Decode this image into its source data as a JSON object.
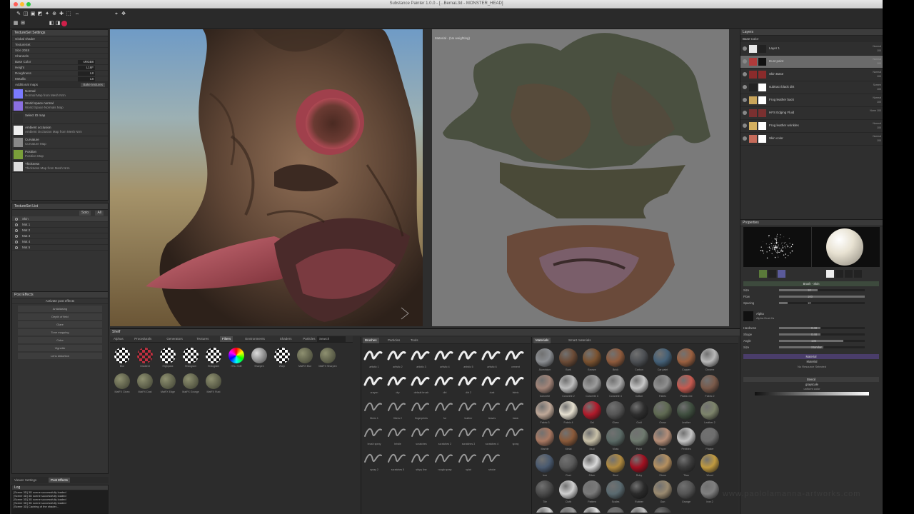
{
  "window": {
    "title": "Substance Painter 1.0.0 - [...BernaL3d - MONSTER_HEAD]"
  },
  "left": {
    "texset_settings": {
      "header": "TextureSet Settings",
      "rows": [
        {
          "label": "Global shader",
          "value": ""
        },
        {
          "label": "TextureSet",
          "value": ""
        },
        {
          "label": "Size  2048",
          "value": ""
        },
        {
          "label": "Channels",
          "value": ""
        },
        {
          "label": "Base Color",
          "value": "sRGB8"
        },
        {
          "label": "Height",
          "value": "L16F"
        },
        {
          "label": "Roughness",
          "value": "L8"
        },
        {
          "label": "Metallic",
          "value": "L8"
        }
      ],
      "maps_label": "Additional maps",
      "maps_button": "Bake textures",
      "maps": [
        {
          "name": "Normal",
          "sub": "Normal Map from Mesh Nrm",
          "color": "#7a7aff"
        },
        {
          "name": "World space normal",
          "sub": "World Space Normals Map",
          "color": "#8a6fe0"
        },
        {
          "name": "Select ID map",
          "sub": "",
          "color": "#2f2f2f"
        },
        {
          "name": "Ambient occlusion",
          "sub": "Ambient Occlusion Map from Mesh Nrm",
          "color": "#eeeeee"
        },
        {
          "name": "Curvature",
          "sub": "Curvature Map",
          "color": "#888888"
        },
        {
          "name": "Position",
          "sub": "Position Map",
          "color": "#7a9f3a"
        },
        {
          "name": "Thickness",
          "sub": "Thickness Map from Mesh Nrm",
          "color": "#dddddd"
        }
      ]
    },
    "texset_list": {
      "header": "TextureSet List",
      "solo_label": "Solo",
      "all_label": "All",
      "items": [
        "Skin",
        "Mat 1",
        "Mat 2",
        "Mat 3",
        "Mat 4",
        "Mat 5"
      ]
    },
    "post_effects": {
      "header": "Post Effects",
      "activate": "Activate post effects",
      "items": [
        "Antialiasing",
        "Depth of field",
        "Glare",
        "Tone mapping",
        "Color",
        "Vignette",
        "Lens distortion"
      ]
    },
    "bottom_tabs": [
      "Viewer Settings",
      "Post Effects"
    ],
    "log": {
      "header": "Log",
      "lines": [
        "[Scene 3D] 3D scene successfully loaded",
        "[Scene 3D] 3D scene successfully loaded",
        "[Scene 3D] 3D scene successfully loaded",
        "[Scene 3D] 3D scene successfully loaded",
        "[Scene 3D] Caching of the shader..."
      ]
    }
  },
  "viewport2d": {
    "label": "Material - (No weighting)"
  },
  "shelf": {
    "header": "Shelf",
    "tabs": [
      "Alphas",
      "Procedurals",
      "Generators",
      "Textures",
      "Filters",
      "Environments",
      "Shaders",
      "Particles",
      "All"
    ],
    "active_tab": "Filters",
    "search": "Search",
    "filters": [
      {
        "label": "Blur",
        "kind": "check"
      },
      {
        "label": "Gradient",
        "kind": "red"
      },
      {
        "label": "Highpass",
        "kind": "check"
      },
      {
        "label": "Histogram",
        "kind": "check"
      },
      {
        "label": "Histogram",
        "kind": "check"
      },
      {
        "label": "HSL Shift",
        "kind": "rainbow"
      },
      {
        "label": "Sharpen",
        "kind": "grey"
      },
      {
        "label": "Warp",
        "kind": "check"
      },
      {
        "label": "MatFX Blur",
        "kind": "olive"
      },
      {
        "label": "MatFX Sharpen",
        "kind": "olive"
      },
      {
        "label": "MatFX Clean",
        "kind": "olive"
      },
      {
        "label": "MatFX Dust",
        "kind": "olive"
      },
      {
        "label": "MatFX Edge",
        "kind": "olive"
      },
      {
        "label": "MatFX Grunge",
        "kind": "olive"
      },
      {
        "label": "MatFX Rust",
        "kind": "olive"
      }
    ],
    "brush_tabs": [
      "Brushes",
      "Particles",
      "Tools"
    ],
    "brush_labels": [
      "artistic 1",
      "artistic 2",
      "artistic 3",
      "artistic 4",
      "artistic 5",
      "artistic 6",
      "cement",
      "crayon",
      "dry",
      "default brush",
      "dirt",
      "dirt 2",
      "dust",
      "fabric",
      "fibers 1",
      "fibers 2",
      "fingerprints",
      "fur",
      "leather",
      "leaves",
      "basic",
      "brush spray",
      "bristle",
      "scratches",
      "scratches 2",
      "scratches 3",
      "scratches 4",
      "spray",
      "spray 2",
      "scratches 5",
      "stripy line",
      "rough spray",
      "splat",
      "stroke"
    ],
    "mat_tabs": [
      "Materials",
      "Smart materials"
    ],
    "materials": [
      {
        "label": "Aluminium",
        "c": "#8a8d91"
      },
      {
        "label": "Bark",
        "c": "#6b4b36"
      },
      {
        "label": "Bronze",
        "c": "#7a5230"
      },
      {
        "label": "Brick",
        "c": "#8e5a3c"
      },
      {
        "label": "Carbon",
        "c": "#4d5054"
      },
      {
        "label": "Car paint",
        "c": "#446077"
      },
      {
        "label": "Copper",
        "c": "#9a6040"
      },
      {
        "label": "Chrome",
        "c": "#b8b8b8"
      },
      {
        "label": "Concrete",
        "c": "#a28478"
      },
      {
        "label": "Concrete 2",
        "c": "#bdbdbd"
      },
      {
        "label": "Concrete 3",
        "c": "#9c9c9c"
      },
      {
        "label": "Concrete 4",
        "c": "#ababab"
      },
      {
        "label": "Cotton",
        "c": "#c7c7c7"
      },
      {
        "label": "Fabric",
        "c": "#8f8f8f"
      },
      {
        "label": "Plastic red",
        "c": "#c55a50"
      },
      {
        "label": "Fabric 2",
        "c": "#7a5a4a"
      },
      {
        "label": "Fabric 3",
        "c": "#bfa898"
      },
      {
        "label": "Fabric 4",
        "c": "#e6e0d0"
      },
      {
        "label": "Gel",
        "c": "#b01a2a"
      },
      {
        "label": "Glass",
        "c": "#555"
      },
      {
        "label": "Gold",
        "c": "#2d2d2d"
      },
      {
        "label": "Grass",
        "c": "#5f6a52"
      },
      {
        "label": "Leather",
        "c": "#3f4e3f"
      },
      {
        "label": "Leather 2",
        "c": "#7d846b"
      },
      {
        "label": "Marble",
        "c": "#a87862"
      },
      {
        "label": "Metal",
        "c": "#8a5a3a"
      },
      {
        "label": "Mud",
        "c": "#c8c0a8"
      },
      {
        "label": "Moss",
        "c": "#5b6a66"
      },
      {
        "label": "Paint",
        "c": "#6f7a6f"
      },
      {
        "label": "Paper",
        "c": "#b58e78"
      },
      {
        "label": "Pebbles",
        "c": "#c4c4c4"
      },
      {
        "label": "Plaster",
        "c": "#6d6d6d"
      },
      {
        "label": "Iron",
        "c": "#4a5a70"
      },
      {
        "label": "Rust",
        "c": "#5a5a5a"
      },
      {
        "label": "Silver",
        "c": "#d8d8d8"
      },
      {
        "label": "Steel",
        "c": "#b08a40"
      },
      {
        "label": "Ruby",
        "c": "#a01020"
      },
      {
        "label": "Stone",
        "c": "#b59060"
      },
      {
        "label": "Titan",
        "c": "#3a3a3a"
      },
      {
        "label": "Wood",
        "c": "#c09a40"
      },
      {
        "label": "Tile",
        "c": "#4a4a4a"
      },
      {
        "label": "Cloth",
        "c": "#d0d0d0"
      },
      {
        "label": "Pattern",
        "c": "#7a7a7a"
      },
      {
        "label": "Scales",
        "c": "#5a6a70"
      },
      {
        "label": "Rubber",
        "c": "#2a2a2a"
      },
      {
        "label": "Gun",
        "c": "#9a8a70"
      },
      {
        "label": "Grunge",
        "c": "#555"
      },
      {
        "label": "Iron 2",
        "c": "#808080"
      },
      {
        "label": "Silver 2",
        "c": "#d0d0d0"
      },
      {
        "label": "Steel 2",
        "c": "#999"
      },
      {
        "label": "Chrome 2",
        "c": "#e0e0e0"
      },
      {
        "label": "Iron 3",
        "c": "#6a6a6a"
      },
      {
        "label": "Wire",
        "c": "#c0c0c0"
      },
      {
        "label": "Metal 2",
        "c": "#4a4a4a"
      }
    ]
  },
  "right": {
    "layers_header": "Layers",
    "layers_toolbar": "Base Color",
    "layers": [
      {
        "name": "Layer 1",
        "blend": "Normal\n100",
        "t1": "#e8e8e8",
        "t2": "#222"
      },
      {
        "name": "Dust paint",
        "blend": "Normal\n100",
        "t1": "#b03b3b",
        "t2": "#111",
        "sel": true
      },
      {
        "name": "Skin Base",
        "blend": "Normal\n100",
        "t1": "#8a2b2b",
        "t2": "#8a2b2b"
      },
      {
        "name": "subtract black dirt",
        "blend": "Screen\n100",
        "t1": "#222",
        "t2": "#fff"
      },
      {
        "name": "Frog leather back",
        "blend": "Normal\n100",
        "t1": "#c9a55a",
        "t2": "#fff"
      },
      {
        "name": "HFS Edging Fluid",
        "blend": "Norm 100",
        "t1": "#7a3030",
        "t2": "#7a3030"
      },
      {
        "name": "Frog leather wrinkles",
        "blend": "Normal\n100",
        "t1": "#d4b060",
        "t2": "#fff"
      },
      {
        "name": "Skin color",
        "blend": "Normal\n100",
        "t1": "#c56b5a",
        "t2": "#fff"
      }
    ],
    "props_header": "Properties",
    "brush_section": "Brush - Skin",
    "brush_props": [
      {
        "label": "Size",
        "value": "10",
        "pct": 0.45
      },
      {
        "label": "Flow",
        "value": "100",
        "pct": 1.0
      },
      {
        "label": "Spacing",
        "value": "10",
        "pct": 0.1
      }
    ],
    "alpha_label": "Alpha",
    "alpha_name": "Alpha Dust 2a",
    "props2": [
      {
        "label": "Hardness",
        "value": "0.48",
        "pct": 0.48
      },
      {
        "label": "Shape",
        "value": "0.48",
        "pct": 0.48
      },
      {
        "label": "Angle",
        "value": "135",
        "pct": 0.75
      },
      {
        "label": "Size",
        "value": "Standard",
        "pct": 0.5
      }
    ],
    "material_section": "Material",
    "material_sub": "Material",
    "material_none": "No Resource Selected",
    "stencil_section": "Stencil",
    "stencil_name": "grayscale",
    "stencil_sub": "uniform color"
  },
  "watermark": "www.paololamanna-artworks.com"
}
